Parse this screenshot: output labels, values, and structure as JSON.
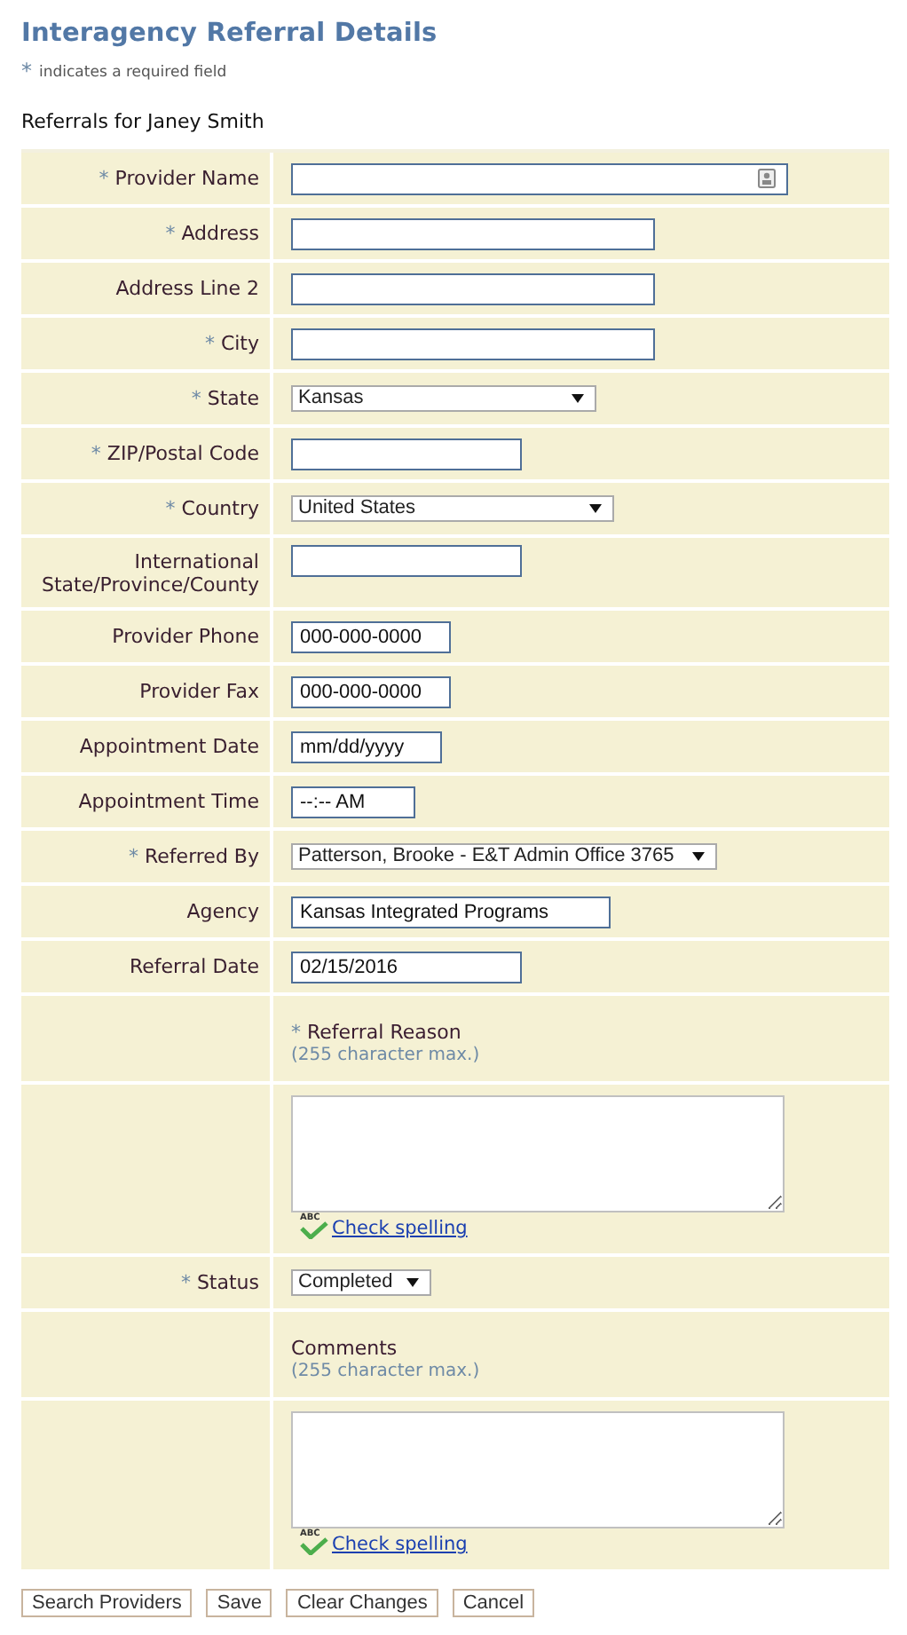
{
  "title": "Interagency Referral Details",
  "required_note": {
    "mark": "*",
    "text": "indicates a required field"
  },
  "subtitle": "Referrals for Janey Smith",
  "rows": [
    {
      "kind": "lookup",
      "label": "Provider Name",
      "required_mark": "*"
    },
    {
      "kind": "text",
      "label": "Address",
      "required_mark": "*"
    },
    {
      "kind": "text",
      "label": "Address Line 2"
    },
    {
      "kind": "text",
      "label": "City",
      "required_mark": "*"
    },
    {
      "kind": "select",
      "label": "State",
      "required_mark": "*",
      "value": "Kansas"
    },
    {
      "kind": "text",
      "label": "ZIP/Postal Code",
      "required_mark": "*"
    },
    {
      "kind": "select",
      "label": "Country",
      "required_mark": "*",
      "value": "United States"
    },
    {
      "kind": "text",
      "label": "International State/Province/County"
    },
    {
      "kind": "text",
      "label": "Provider Phone",
      "value": "000-000-0000"
    },
    {
      "kind": "text",
      "label": "Provider Fax",
      "value": "000-000-0000"
    },
    {
      "kind": "text",
      "label": "Appointment Date",
      "value": "mm/dd/yyyy"
    },
    {
      "kind": "text",
      "label": "Appointment Time",
      "value": "--:-- AM"
    },
    {
      "kind": "select",
      "label": "Referred By",
      "required_mark": "*",
      "value": "Patterson, Brooke - E&T Admin Office 3765"
    },
    {
      "kind": "text",
      "label": "Agency",
      "value": "Kansas Integrated Programs"
    },
    {
      "kind": "text",
      "label": "Referral Date",
      "value": "02/15/2016"
    },
    {
      "kind": "heading",
      "label": "Referral Reason",
      "required_mark": "*",
      "note": "(255 character max.)"
    },
    {
      "kind": "textarea",
      "icon_text": "ABC",
      "link": "Check spelling"
    },
    {
      "kind": "select",
      "label": "Status",
      "required_mark": "*",
      "value": "Completed"
    },
    {
      "kind": "heading",
      "label": "Comments",
      "note": "(255 character max.)"
    },
    {
      "kind": "textarea",
      "icon_text": "ABC",
      "link": "Check spelling"
    }
  ],
  "buttons": [
    "Search Providers",
    "Save",
    "Clear Changes",
    "Cancel"
  ]
}
